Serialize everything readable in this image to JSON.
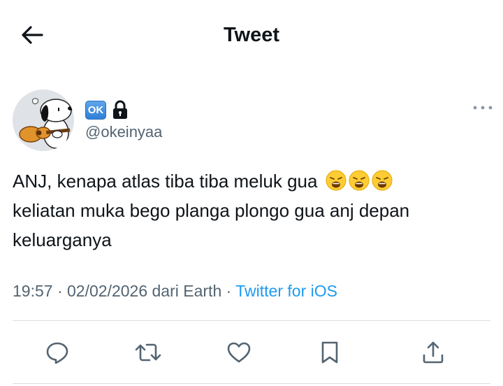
{
  "header": {
    "title": "Tweet",
    "back_icon": "arrow-left-icon"
  },
  "author": {
    "badge": "OK",
    "handle": "@okeinyaa",
    "protected_icon": "lock-icon"
  },
  "tweet": {
    "text_line1": "ANJ, kenapa atlas tiba tiba meluk gua",
    "emojis": [
      "weary-face-icon",
      "weary-face-icon",
      "weary-face-icon"
    ],
    "text_line2": "keliatan muka bego planga plongo gua anj depan",
    "text_line3": "keluarganya"
  },
  "meta": {
    "time": "19:57",
    "separator": "·",
    "date": "02/02/2026 dari Earth",
    "separator2": "·",
    "source": "Twitter for iOS"
  },
  "colors": {
    "text": "#0f1419",
    "secondary": "#536471",
    "link": "#1d9bf0",
    "divider": "#d9dee2"
  },
  "actions": [
    "reply-icon",
    "retweet-icon",
    "like-icon",
    "bookmark-icon",
    "share-icon"
  ]
}
